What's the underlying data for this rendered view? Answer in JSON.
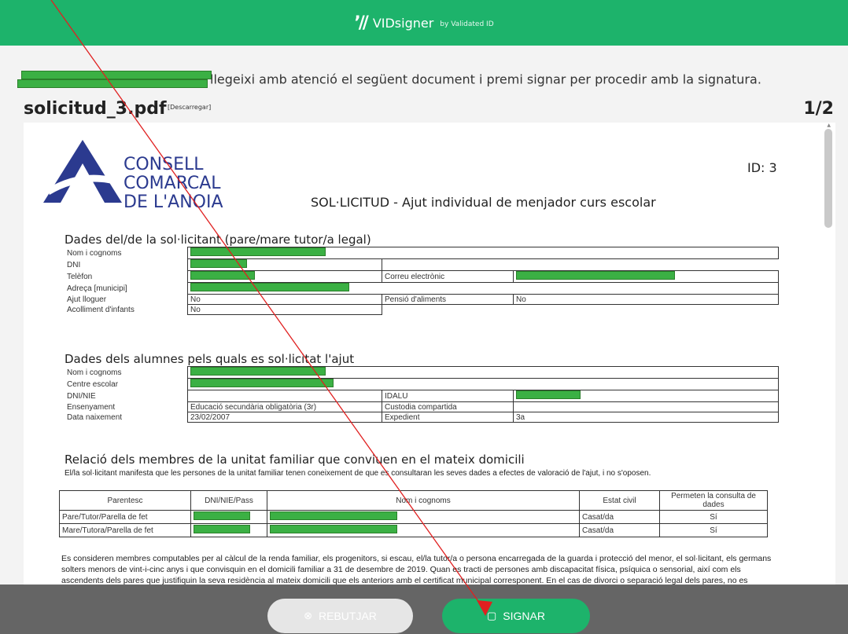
{
  "header": {
    "brand_icon": "’//",
    "brand_name": "VIDsigner",
    "brand_by": "by Validated ID",
    "color": "#1db36b"
  },
  "instruction": {
    "text": "llegeixi amb atenció el següent document i premi signar per procedir amb la signatura."
  },
  "document": {
    "file_name": "solicitud_3.pdf",
    "download_label": "[Descarregar]",
    "page_indicator": "1/2"
  },
  "pdf": {
    "logo_lines": [
      "CONSELL",
      "COMARCAL",
      "DE L'ANOIA"
    ],
    "id_label": "ID: 3",
    "title": "SOL·LICITUD - Ajut individual de menjador curs escolar",
    "section1": {
      "title": "Dades del/de la sol·licitant (pare/mare tutor/a legal)",
      "labels": {
        "name": "Nom i cognoms",
        "dni": "DNI",
        "phone": "Telèfon",
        "email": "Correu electrònic",
        "address": "Adreça [municipi]",
        "rent": "Ajut lloguer",
        "alimony": "Pensió d'aliments",
        "foster": "Acolliment d'infants"
      },
      "values": {
        "rent": "No",
        "alimony": "No",
        "foster": "No"
      }
    },
    "section2": {
      "title": "Dades dels alumnes pels quals es sol·licitat l'ajut",
      "labels": {
        "name": "Nom i cognoms",
        "school": "Centre escolar",
        "dni": "DNI/NIE",
        "idalu": "IDALU",
        "teaching": "Ensenyament",
        "custody": "Custodia compartida",
        "birth": "Data naixement",
        "file": "Expedient"
      },
      "values": {
        "teaching": "Educació secundària obligatòria (3r)",
        "birth": "23/02/2007",
        "file": "3a"
      }
    },
    "section3": {
      "title": "Relació dels membres de la unitat familiar que conviuen en el mateix domicili",
      "intro": "El/la sol·licitant manifesta que les persones de la unitat familiar tenen coneixement de que es consultaran les seves dades a efectes de valoració de l'ajut, i no s'oposen.",
      "headers": [
        "Parentesc",
        "DNI/NIE/Pass",
        "Nom i cognoms",
        "Estat civil",
        "Permeten la consulta de dades"
      ],
      "rows": [
        {
          "relation": "Pare/Tutor/Parella de fet",
          "civil": "Casat/da",
          "consent": "Sí"
        },
        {
          "relation": "Mare/Tutora/Parella de fet",
          "civil": "Casat/da",
          "consent": "Sí"
        }
      ],
      "note": "Es consideren membres computables per al càlcul de la renda familiar, els progenitors, si escau, el/la tutor/a o persona encarregada de la guarda i protecció del menor, el sol·licitant, els germans solters menors de vint-i-cinc anys i que convisquin en el domicili familiar a 31 de desembre de 2019. Quan es tracti de persones amb discapacitat física, psíquica o sensorial, així com els ascendents dels pares que justifiquin la seva residència al mateix domicili que els anteriors amb el certificat municipal corresponent. En el cas de divorci o separació legal dels pares, no es considerarà membre"
    }
  },
  "footer": {
    "reject_label": "REBUTJAR",
    "sign_label": "SIGNAR"
  },
  "colors": {
    "accent": "#1db36b",
    "redaction": "#3bb044",
    "annotation": "#e02020"
  }
}
